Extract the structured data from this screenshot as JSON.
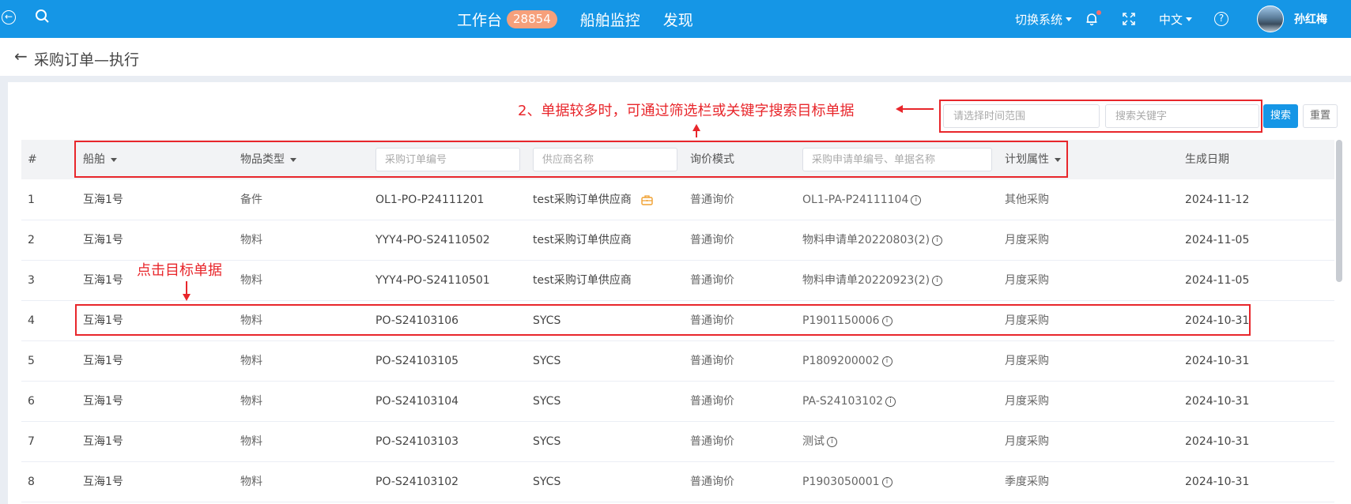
{
  "topbar": {
    "nav": {
      "workbench": "工作台",
      "workbench_count": "28854",
      "ship_monitor": "船舶监控",
      "discover": "发现"
    },
    "switch_system": "切换系统",
    "language": "中文",
    "help": "?",
    "username": "孙红梅"
  },
  "page": {
    "title": "采购订单—执行"
  },
  "search": {
    "time_range_placeholder": "请选择时间范围",
    "keyword_placeholder": "搜索关键字",
    "search_button": "搜索",
    "reset_button": "重置"
  },
  "table": {
    "headers": {
      "index": "#",
      "ship": "船舶",
      "item_type": "物品类型",
      "po_number_placeholder": "采购订单编号",
      "supplier_placeholder": "供应商名称",
      "inquiry_mode": "询价模式",
      "request_placeholder": "采购申请单编号、单据名称",
      "plan_attr": "计划属性",
      "created_date": "生成日期"
    },
    "rows": [
      {
        "index": "1",
        "ship": "互海1号",
        "item_type": "备件",
        "po": "OL1-PO-P24111201",
        "supplier": "test采购订单供应商",
        "inquiry": "普通询价",
        "request": "OL1-PA-P24111104",
        "plan": "其他采购",
        "date": "2024-11-12"
      },
      {
        "index": "2",
        "ship": "互海1号",
        "item_type": "物料",
        "po": "YYY4-PO-S24110502",
        "supplier": "test采购订单供应商",
        "inquiry": "普通询价",
        "request": "物料申请单20220803(2)",
        "plan": "月度采购",
        "date": "2024-11-05"
      },
      {
        "index": "3",
        "ship": "互海1号",
        "item_type": "物料",
        "po": "YYY4-PO-S24110501",
        "supplier": "test采购订单供应商",
        "inquiry": "普通询价",
        "request": "物料申请单20220923(2)",
        "plan": "月度采购",
        "date": "2024-11-05"
      },
      {
        "index": "4",
        "ship": "互海1号",
        "item_type": "物料",
        "po": "PO-S24103106",
        "supplier": "SYCS",
        "inquiry": "普通询价",
        "request": "P1901150006",
        "plan": "月度采购",
        "date": "2024-10-31"
      },
      {
        "index": "5",
        "ship": "互海1号",
        "item_type": "物料",
        "po": "PO-S24103105",
        "supplier": "SYCS",
        "inquiry": "普通询价",
        "request": "P1809200002",
        "plan": "月度采购",
        "date": "2024-10-31"
      },
      {
        "index": "6",
        "ship": "互海1号",
        "item_type": "物料",
        "po": "PO-S24103104",
        "supplier": "SYCS",
        "inquiry": "普通询价",
        "request": "PA-S24103102",
        "plan": "月度采购",
        "date": "2024-10-31"
      },
      {
        "index": "7",
        "ship": "互海1号",
        "item_type": "物料",
        "po": "PO-S24103103",
        "supplier": "SYCS",
        "inquiry": "普通询价",
        "request": "测试",
        "plan": "月度采购",
        "date": "2024-10-31"
      },
      {
        "index": "8",
        "ship": "互海1号",
        "item_type": "物料",
        "po": "PO-S24103102",
        "supplier": "SYCS",
        "inquiry": "普通询价",
        "request": "P1903050001",
        "plan": "季度采购",
        "date": "2024-10-31"
      }
    ]
  },
  "annotations": {
    "filter_hint": "2、单据较多时，可通过筛选栏或关键字搜索目标单据",
    "click_hint": "点击目标单据"
  },
  "colors": {
    "primary": "#1596e6",
    "badge": "#f6a07b",
    "annotation": "#e8262b"
  }
}
